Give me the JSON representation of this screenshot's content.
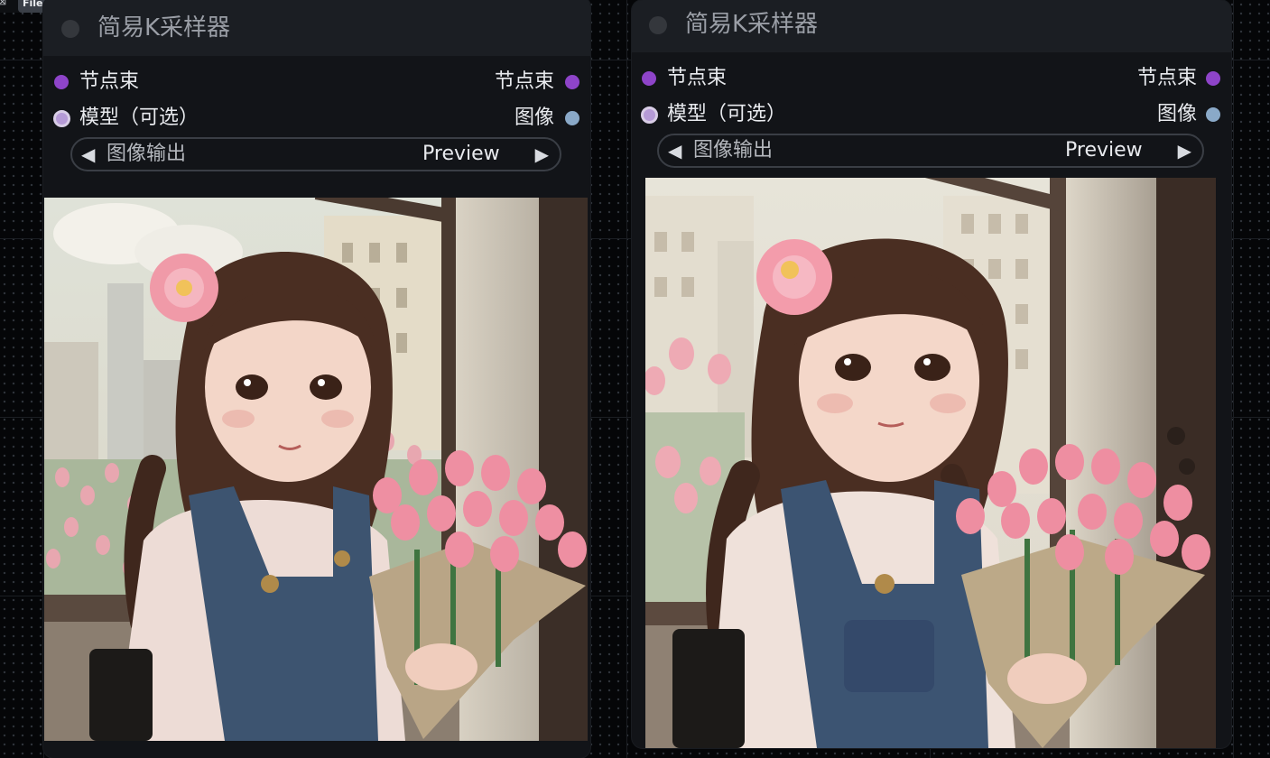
{
  "menu": {
    "file_label": "File",
    "file_chevron": "▾"
  },
  "nodes": [
    {
      "title": "简易K采样器",
      "input_bundle": "节点束",
      "input_model": "模型（可选）",
      "output_bundle": "节点束",
      "output_image": "图像",
      "widget_label": "图像输出",
      "widget_value": "Preview",
      "arrow_left": "◀",
      "arrow_right": "▶"
    },
    {
      "title": "简易K采样器",
      "input_bundle": "节点束",
      "input_model": "模型（可选）",
      "output_bundle": "节点束",
      "output_image": "图像",
      "widget_label": "图像输出",
      "widget_value": "Preview",
      "arrow_left": "◀",
      "arrow_right": "▶"
    }
  ],
  "colors": {
    "canvas_bg": "#050608",
    "node_bg": "#121418",
    "title_bar": "#1b1e23",
    "slot_purple": "#8e44c9",
    "slot_model": "#b59ad6",
    "slot_image": "#8aa9c8"
  },
  "icons": {
    "menu": "collapse-icon",
    "lock": "lock-icon",
    "slot": "circle-dot"
  }
}
